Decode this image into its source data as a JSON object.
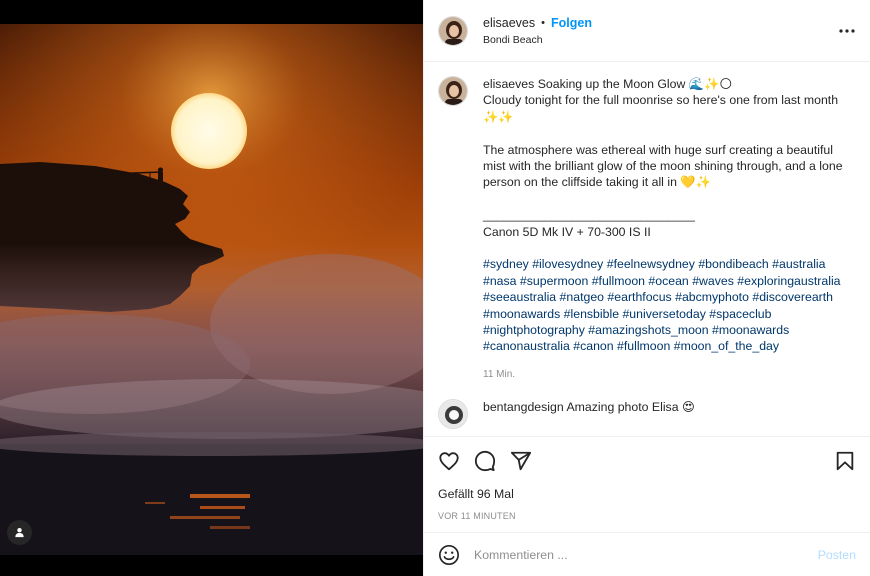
{
  "post": {
    "username": "elisaeves",
    "dot": "•",
    "follow_label": "Folgen",
    "location": "Bondi Beach",
    "more_icon": "more-horizontal-icon"
  },
  "caption": {
    "username": "elisaeves",
    "line1": "Soaking up the Moon Glow 🌊✨🌕",
    "line2": "Cloudy tonight for the full moonrise so here's one from last month ✨✨",
    "line3": "The atmosphere was ethereal with huge surf creating a beautiful mist with the brilliant glow of the moon shining through, and a lone person on the cliffside taking it all in 💛✨",
    "divider": "_______________________________",
    "gear": "Canon 5D Mk IV + 70-300 IS II",
    "hashtags": "#sydney #ilovesydney #feelnewsydney #bondibeach #australia #nasa #supermoon #fullmoon #ocean #waves #exploringaustralia #seeaustralia #natgeo #earthfocus #abcmyphoto #discoverearth #moonawards #lensbible #universetoday #spaceclub #nightphotography #amazingshots_moon #moonawards #canonaustralia #canon #fullmoon #moon_of_the_day",
    "time": "11 Min."
  },
  "comment": {
    "username": "bentangdesign",
    "text": "Amazing photo Elisa 😍"
  },
  "actions": {
    "likes": "Gefällt 96 Mal",
    "posted_ago": "VOR 11 MINUTEN"
  },
  "composer": {
    "placeholder": "Kommentieren ...",
    "post_label": "Posten"
  },
  "colors": {
    "link_blue": "#0095f6",
    "hashtag_blue": "#00376b",
    "muted": "#8e8e8e",
    "post_disabled": "#b3dbff"
  }
}
